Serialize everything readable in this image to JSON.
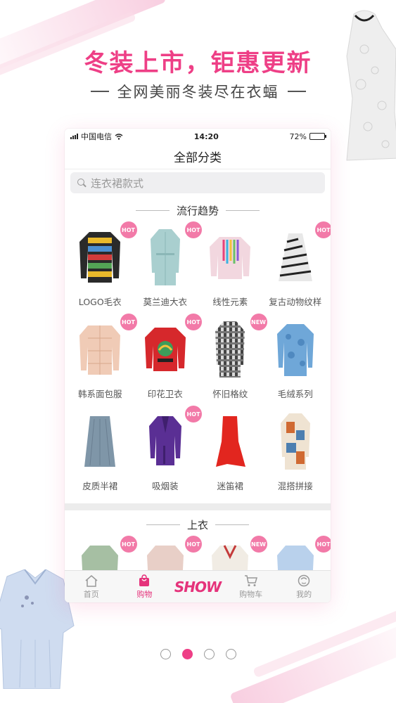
{
  "promo": {
    "headline": "冬装上市，钜惠更新",
    "subline": "全网美丽冬装尽在衣蝠"
  },
  "status_bar": {
    "carrier": "中国电信",
    "time": "14:20",
    "battery": "72%",
    "battery_level": 0.72
  },
  "nav": {
    "title": "全部分类"
  },
  "search": {
    "placeholder": "连衣裙款式"
  },
  "trend_section": {
    "title": "流行趋势",
    "items": [
      {
        "label": "LOGO毛衣",
        "badge": "HOT"
      },
      {
        "label": "莫兰迪大衣",
        "badge": "HOT"
      },
      {
        "label": "线性元素",
        "badge": ""
      },
      {
        "label": "复古动物纹样",
        "badge": "HOT"
      },
      {
        "label": "韩系面包服",
        "badge": "HOT"
      },
      {
        "label": "印花卫衣",
        "badge": "HOT"
      },
      {
        "label": "怀旧格纹",
        "badge": "NEW"
      },
      {
        "label": "毛绒系列",
        "badge": ""
      },
      {
        "label": "皮质半裙",
        "badge": ""
      },
      {
        "label": "吸烟装",
        "badge": "HOT"
      },
      {
        "label": "迷笛裙",
        "badge": ""
      },
      {
        "label": "混搭拼接",
        "badge": ""
      }
    ]
  },
  "tops_section": {
    "title": "上衣",
    "items": [
      {
        "badge": "HOT"
      },
      {
        "badge": "HOT"
      },
      {
        "badge": "NEW"
      },
      {
        "badge": "HOT"
      }
    ]
  },
  "tabbar": {
    "home": "首页",
    "shop": "购物",
    "show": "SHOW",
    "cart": "购物车",
    "mine": "我的"
  },
  "pager": {
    "count": 4,
    "active": 2
  },
  "colors": {
    "brand": "#ee3f86",
    "badge": "#f27aa8"
  }
}
